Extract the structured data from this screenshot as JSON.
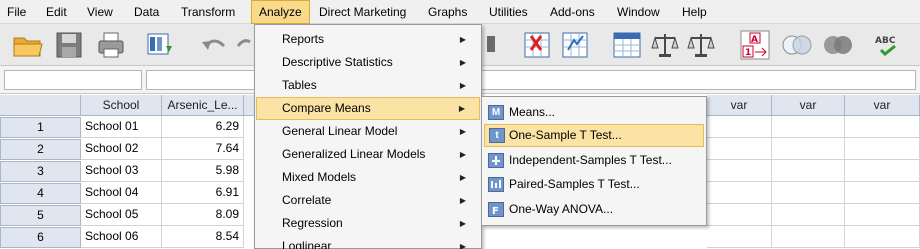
{
  "menubar": {
    "items": [
      "File",
      "Edit",
      "View",
      "Data",
      "Transform",
      "Analyze",
      "Direct Marketing",
      "Graphs",
      "Utilities",
      "Add-ons",
      "Window",
      "Help"
    ],
    "active": "Analyze"
  },
  "toolbar": {
    "icons": [
      "open-folder-icon",
      "save-icon",
      "print-icon",
      "recall-dialog-icon",
      "undo-icon",
      "redo-icon",
      "goto-case-icon",
      "find-icon",
      "insert-cases-icon",
      "insert-variable-icon",
      "split-file-icon",
      "weight-cases-icon",
      "select-cases-icon",
      "value-labels-icon",
      "use-sets-icon",
      "show-all-icon",
      "spell-check-icon"
    ]
  },
  "cell_editor": {
    "ref": "",
    "value": ""
  },
  "grid": {
    "columns": [
      "School",
      "Arsenic_Le...",
      "var",
      "var",
      "var"
    ],
    "rows": [
      {
        "num": "1",
        "school": "School 01",
        "arsenic": "6.29"
      },
      {
        "num": "2",
        "school": "School 02",
        "arsenic": "7.64"
      },
      {
        "num": "3",
        "school": "School 03",
        "arsenic": "5.98"
      },
      {
        "num": "4",
        "school": "School 04",
        "arsenic": "6.91"
      },
      {
        "num": "5",
        "school": "School 05",
        "arsenic": "8.09"
      },
      {
        "num": "6",
        "school": "School 06",
        "arsenic": "8.54"
      }
    ]
  },
  "analyze_menu": {
    "items": [
      "Reports",
      "Descriptive Statistics",
      "Tables",
      "Compare Means",
      "General Linear Model",
      "Generalized Linear Models",
      "Mixed Models",
      "Correlate",
      "Regression",
      "Loglinear"
    ],
    "highlighted": "Compare Means"
  },
  "compare_means_submenu": {
    "items": [
      "Means...",
      "One-Sample T Test...",
      "Independent-Samples T Test...",
      "Paired-Samples T Test...",
      "One-Way ANOVA..."
    ],
    "icons": [
      "M",
      "t",
      "",
      "",
      ""
    ],
    "highlighted": "One-Sample T Test..."
  },
  "colors": {
    "menu_highlight": "#fbe3a5",
    "menu_highlight_border": "#e4bd5b",
    "active_menu": "#f9d98a",
    "header_bg": "#dfe6ef"
  }
}
